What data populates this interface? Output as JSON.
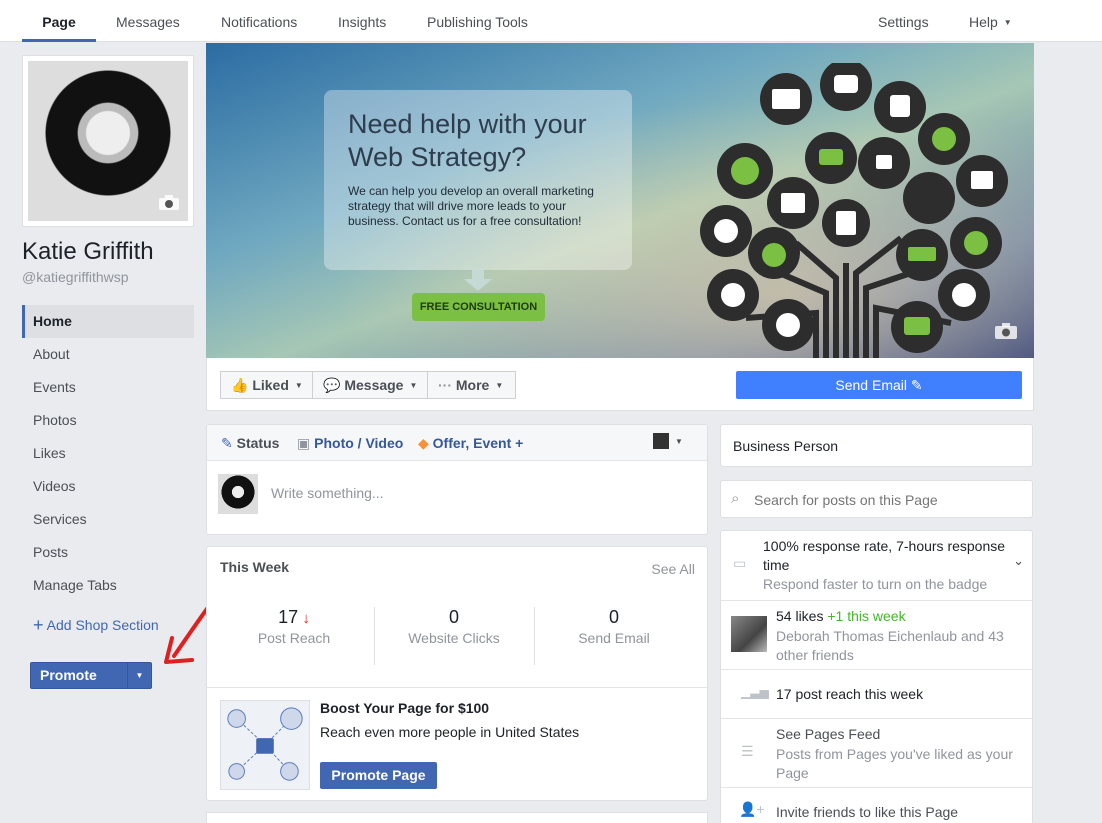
{
  "nav": {
    "tabs": [
      "Page",
      "Messages",
      "Notifications",
      "Insights",
      "Publishing Tools"
    ],
    "settings": "Settings",
    "help": "Help"
  },
  "profile": {
    "name": "Katie Griffith",
    "handle": "@katiegriffithwsp"
  },
  "sidebar": {
    "items": [
      "Home",
      "About",
      "Events",
      "Photos",
      "Likes",
      "Videos",
      "Services",
      "Posts",
      "Manage Tabs"
    ],
    "add_shop": "Add Shop Section",
    "promote": "Promote"
  },
  "cover": {
    "headline": "Need help with your Web Strategy?",
    "body": "We can help you develop an overall marketing strategy that will drive more leads to your business. Contact us for a free consultation!",
    "cta": "FREE CONSULTATION"
  },
  "actions": {
    "liked": "Liked",
    "message": "Message",
    "more": "More",
    "send_email": "Send Email"
  },
  "composer": {
    "status": "Status",
    "photo": "Photo / Video",
    "offer": "Offer, Event +",
    "placeholder": "Write something..."
  },
  "this_week": {
    "title": "This Week",
    "see_all": "See All",
    "stats": [
      {
        "value": "17",
        "label": "Post Reach"
      },
      {
        "value": "0",
        "label": "Website Clicks"
      },
      {
        "value": "0",
        "label": "Send Email"
      }
    ],
    "boost_title": "Boost Your Page for $100",
    "boost_sub": "Reach even more people in United States",
    "boost_btn": "Promote Page"
  },
  "right": {
    "category": "Business Person",
    "search_placeholder": "Search for posts on this Page",
    "response_title": "100% response rate, 7-hours response time",
    "response_sub": "Respond faster to turn on the badge",
    "likes_count": "54 likes",
    "likes_week": "+1 this week",
    "likes_friends": "Deborah Thomas Eichenlaub and 43 other friends",
    "reach": "17 post reach this week",
    "feed_title": "See Pages Feed",
    "feed_sub": "Posts from Pages you've liked as your Page",
    "invite": "Invite friends to like this Page"
  },
  "colors": {
    "brand": "#4267b2",
    "send_email": "#4080ff",
    "cta_green": "#7bc043",
    "arrow_red": "#e02020"
  }
}
